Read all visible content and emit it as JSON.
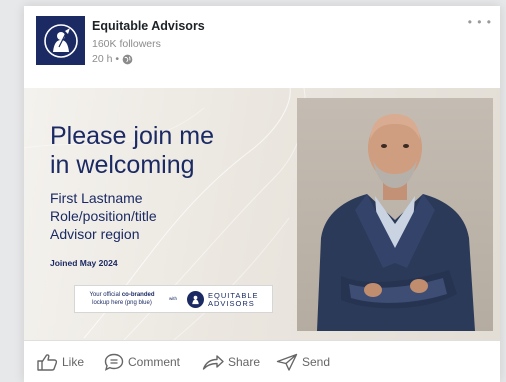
{
  "post": {
    "company_name": "Equitable Advisors",
    "followers": "160K followers",
    "time": "20 h •",
    "more": "• • •"
  },
  "banner": {
    "headline_line1": "Please join me",
    "headline_line2": "in welcoming",
    "name": "First Lastname",
    "role": "Role/position/title",
    "region": "Advisor region",
    "joined": "Joined May 2024",
    "cobrand_line1_prefix": "Your official ",
    "cobrand_line1_bold": "co-branded",
    "cobrand_line2": "lockup here (png blue)",
    "cobrand_with": "with",
    "cobrand_brand_line1": "EQUITABLE",
    "cobrand_brand_line2": "ADVISORS"
  },
  "actions": {
    "like": "Like",
    "comment": "Comment",
    "share": "Share",
    "send": "Send"
  },
  "colors": {
    "brand_navy": "#1b2a63",
    "page_background": "#e7e8e9",
    "muted_text": "#8c8c8c"
  },
  "icons": [
    "company-logo",
    "globe-icon",
    "more-icon",
    "like-icon",
    "comment-icon",
    "share-icon",
    "send-icon"
  ]
}
